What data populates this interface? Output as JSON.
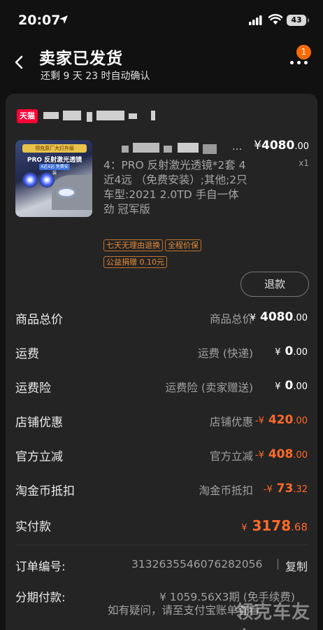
{
  "status_bar": {
    "time": "20:07",
    "battery": "43"
  },
  "header": {
    "title": "卖家已发货",
    "subtitle": "还剩 9 天 23 时自动确认",
    "badge_count": "1"
  },
  "shop": {
    "logo_text": "天猫"
  },
  "product": {
    "title_suffix": "...",
    "price_cur": "¥",
    "price_int": "4080",
    "price_dec": ".00",
    "qty": "x1",
    "sku": "4：PRO 反射激光透镜*2套 4近4远 （免费安装）;其他;2只\n车型:2021 2.0TD 手自一体 劲 冠军版",
    "tags": [
      "七天无理由退换",
      "全程价保"
    ],
    "tags2": [
      "公益捐赠 0.10元"
    ],
    "image": {
      "banner": "领克原厂大灯升级",
      "caption": "PRO 反射激光透镜",
      "tag": "4近4远 免费安装"
    },
    "refund_label": "退款"
  },
  "fees": [
    {
      "label": "商品总价",
      "sub": "商品总价",
      "prefix": "",
      "cur": "¥",
      "int": "4080",
      "dec": ".00",
      "orange": false
    },
    {
      "label": "运费",
      "sub": "运费 (快递)",
      "prefix": "",
      "cur": "¥",
      "int": "0",
      "dec": ".00",
      "orange": false
    },
    {
      "label": "运费险",
      "sub": "运费险 (卖家赠送)",
      "prefix": "",
      "cur": "¥",
      "int": "0",
      "dec": ".00",
      "orange": false
    },
    {
      "label": "店铺优惠",
      "sub": "店铺优惠",
      "prefix": "-",
      "cur": "¥",
      "int": "420",
      "dec": ".00",
      "orange": true
    },
    {
      "label": "官方立减",
      "sub": "官方立减",
      "prefix": "-",
      "cur": "¥",
      "int": "408",
      "dec": ".00",
      "orange": true
    },
    {
      "label": "淘金币抵扣",
      "sub": "淘金币抵扣",
      "prefix": "-",
      "cur": "¥",
      "int": "73",
      "dec": ".32",
      "orange": true
    }
  ],
  "total": {
    "label": "实付款",
    "cur": "¥",
    "int": "3178",
    "dec": ".68"
  },
  "order": {
    "number_label": "订单编号:",
    "number": "3132635546076282056",
    "copy_sep": "|",
    "copy_label": "复制",
    "installment_label": "分期付款:",
    "installment_value": "¥ 1059.56X3期 (免手续费)",
    "note": "如有疑问，请至支付宝账单查看",
    "watermark": "领克车友会"
  },
  "colors": {
    "accent": "#ff6a2a",
    "tmall": "#ff0036",
    "badge": "#ff6a00"
  }
}
